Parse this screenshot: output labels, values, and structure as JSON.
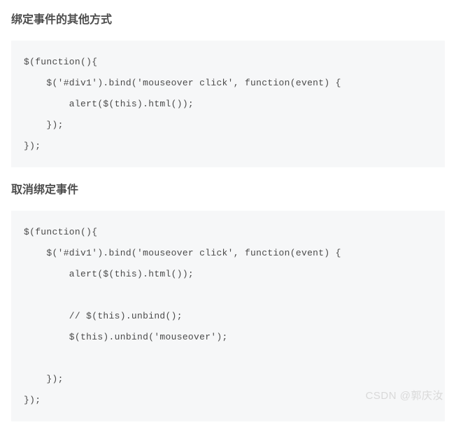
{
  "sections": [
    {
      "heading": "绑定事件的其他方式",
      "code": "$(function(){\n    $('#div1').bind('mouseover click', function(event) {\n        alert($(this).html());\n    });\n});"
    },
    {
      "heading": "取消绑定事件",
      "code": "$(function(){\n    $('#div1').bind('mouseover click', function(event) {\n        alert($(this).html());\n\n        // $(this).unbind();\n        $(this).unbind('mouseover');\n\n    });\n});"
    }
  ],
  "watermark": "CSDN @郭庆汝"
}
